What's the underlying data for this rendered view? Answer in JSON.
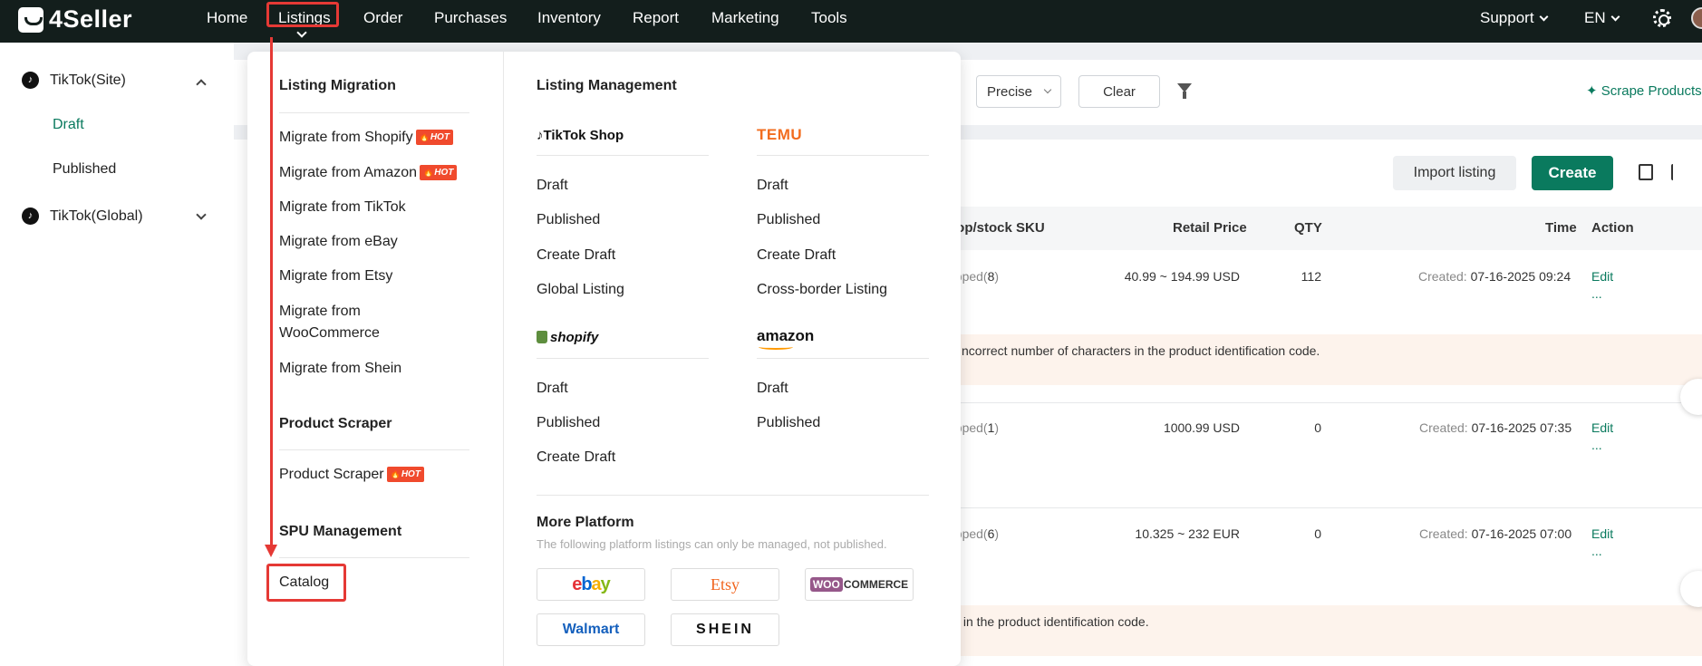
{
  "app": {
    "logo_text": "4Seller",
    "nav": [
      "Home",
      "Listings",
      "Order",
      "Purchases",
      "Inventory",
      "Report",
      "Marketing",
      "Tools"
    ],
    "support": "Support",
    "language": "EN"
  },
  "sidebar": {
    "groups": [
      {
        "label": "TikTok(Site)",
        "items": [
          "Draft",
          "Published"
        ]
      },
      {
        "label": "TikTok(Global)"
      }
    ]
  },
  "toolbar": {
    "search_mode": "Precise",
    "clear": "Clear",
    "scrape": "Scrape Products",
    "import": "Import listing",
    "create": "Create"
  },
  "table": {
    "headers": [
      "hop/stock SKU",
      "Retail Price",
      "QTY",
      "Time",
      "Action"
    ],
    "created_label": "Created:",
    "edit_label": "Edit",
    "more_label": "...",
    "rows": [
      {
        "sku_prefix": "apped(",
        "sku_count": "8",
        "sku_suffix": ")",
        "price": "40.99 ~ 194.99 USD",
        "qty": "112",
        "time": "07-16-2025 09:24"
      },
      {
        "sku_prefix": "apped(",
        "sku_count": "1",
        "sku_suffix": ")",
        "price": "1000.99 USD",
        "qty": "0",
        "time": "07-16-2025 07:35"
      },
      {
        "sku_prefix": "apped(",
        "sku_count": "6",
        "sku_suffix": ")",
        "price": "10.325 ~ 232 EUR",
        "qty": "0",
        "time": "07-16-2025 07:00"
      }
    ],
    "errors": [
      "ncorrect number of characters in the product identification code.",
      "s in the product identification code."
    ]
  },
  "dropdown": {
    "migration": {
      "title": "Listing Migration",
      "items": [
        "Migrate from Shopify",
        "Migrate from Amazon",
        "Migrate from TikTok",
        "Migrate from eBay",
        "Migrate from Etsy",
        "Migrate from WooCommerce",
        "Migrate from Shein"
      ],
      "hot_label": "HOT"
    },
    "scraper": {
      "title": "Product Scraper",
      "items": [
        "Product Scraper"
      ]
    },
    "spu": {
      "title": "SPU Management",
      "items": [
        "Catalog"
      ]
    },
    "management": {
      "title": "Listing Management",
      "tiktok": {
        "brand": "TikTok Shop",
        "items": [
          "Draft",
          "Published",
          "Create Draft",
          "Global Listing"
        ]
      },
      "temu": {
        "brand": "TEMU",
        "items": [
          "Draft",
          "Published",
          "Create Draft",
          "Cross-border Listing"
        ]
      },
      "shopify": {
        "brand": "shopify",
        "items": [
          "Draft",
          "Published",
          "Create Draft"
        ]
      },
      "amazon": {
        "brand": "amazon",
        "items": [
          "Draft",
          "Published"
        ]
      }
    },
    "more": {
      "title": "More Platform",
      "subtitle": "The following platform listings can only be managed, not published.",
      "platforms": [
        "ebay",
        "Etsy",
        "COMMERCE",
        "Walmart",
        "SHEIN"
      ],
      "woo_prefix": "WOO"
    }
  },
  "colors": {
    "brand_green": "#0a7a5e",
    "nav_bg": "#131e1c",
    "annotation_red": "#e53935",
    "hot_red": "#f04a2d"
  }
}
